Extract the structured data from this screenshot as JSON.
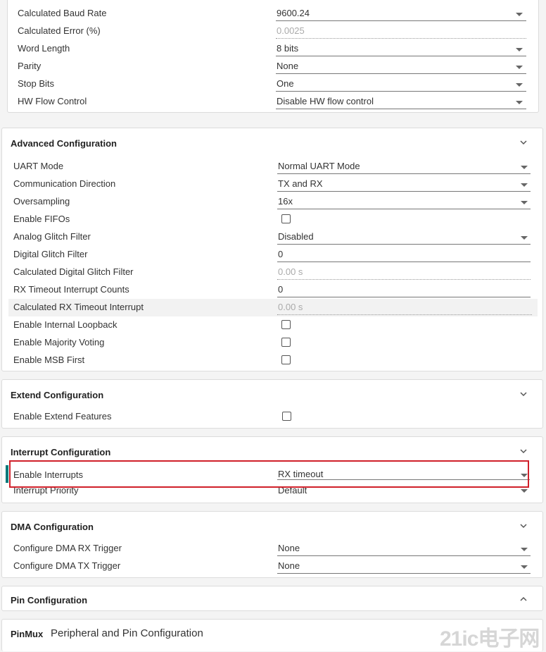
{
  "basic": {
    "rows": [
      {
        "label": "Calculated Baud Rate",
        "value": "9600.24",
        "kind": "select"
      },
      {
        "label": "Calculated Error (%)",
        "value": "0.0025",
        "kind": "readonly"
      },
      {
        "label": "Word Length",
        "value": "8 bits",
        "kind": "select"
      },
      {
        "label": "Parity",
        "value": "None",
        "kind": "select"
      },
      {
        "label": "Stop Bits",
        "value": "One",
        "kind": "select"
      },
      {
        "label": "HW Flow Control",
        "value": "Disable HW flow control",
        "kind": "select"
      }
    ]
  },
  "advanced": {
    "title": "Advanced Configuration",
    "rows": [
      {
        "label": "UART Mode",
        "value": "Normal UART Mode"
      },
      {
        "label": "Communication Direction",
        "value": "TX and RX"
      },
      {
        "label": "Oversampling",
        "value": "16x"
      },
      {
        "label": "Enable FIFOs"
      },
      {
        "label": "Analog Glitch Filter",
        "value": "Disabled"
      },
      {
        "label": "Digital Glitch Filter",
        "value": "0"
      },
      {
        "label": "Calculated Digital Glitch Filter",
        "value": "0.00 s"
      },
      {
        "label": "RX Timeout Interrupt Counts",
        "value": "0"
      },
      {
        "label": "Calculated RX Timeout Interrupt",
        "value": "0.00 s"
      },
      {
        "label": "Enable Internal Loopback"
      },
      {
        "label": "Enable Majority Voting"
      },
      {
        "label": "Enable MSB First"
      }
    ]
  },
  "extend": {
    "title": "Extend Configuration",
    "rows": [
      {
        "label": "Enable Extend Features"
      }
    ]
  },
  "interrupt": {
    "title": "Interrupt Configuration",
    "rows": [
      {
        "label": "Enable Interrupts",
        "value": "RX timeout"
      },
      {
        "label": "Interrupt Priority",
        "value": "Default"
      }
    ],
    "highlight_color": "#d0202a",
    "accent_color": "#00797a"
  },
  "dma": {
    "title": "DMA Configuration",
    "rows": [
      {
        "label": "Configure DMA RX Trigger",
        "value": "None"
      },
      {
        "label": "Configure DMA TX Trigger",
        "value": "None"
      }
    ]
  },
  "pin": {
    "title": "Pin Configuration"
  },
  "pinmux": {
    "badge": "PinMux",
    "title": "Peripheral and Pin Configuration"
  },
  "watermark": {
    "text": "21ic电子网"
  },
  "icons": {
    "chevron_down": "chevron-down-icon",
    "chevron_up": "chevron-up-icon",
    "caret": "caret-down-icon"
  }
}
